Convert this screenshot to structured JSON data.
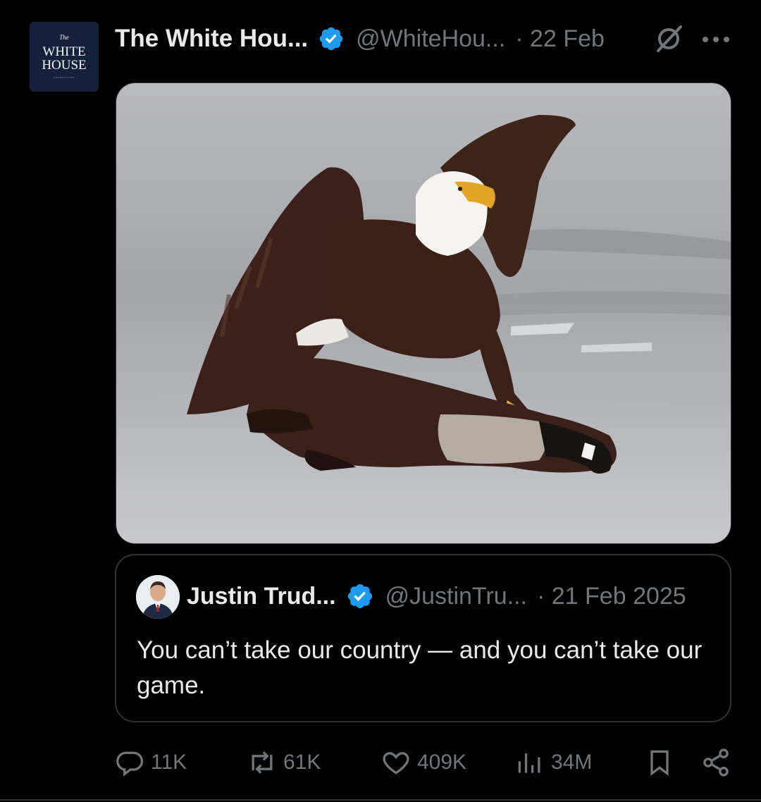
{
  "tweet": {
    "author_name": "The White Hou...",
    "handle": "@WhiteHou...",
    "date": "· 22 Feb",
    "avatar_text": {
      "small_top": "The",
      "line1": "WHITE",
      "line2": "HOUSE",
      "tiny": "WASHINGTON"
    },
    "image_alt": "Bald eagle pinning a Canada goose on ice"
  },
  "quote": {
    "author_name": "Justin Trud...",
    "handle": "@JustinTru...",
    "date": "· 21 Feb 2025",
    "text": "You can’t take our country — and you can’t take our game."
  },
  "actions": {
    "replies": "11K",
    "reposts": "61K",
    "likes": "409K",
    "views": "34M"
  },
  "icons": {
    "verified_color": "#1d9bf0",
    "muted_color": "#71767b"
  }
}
